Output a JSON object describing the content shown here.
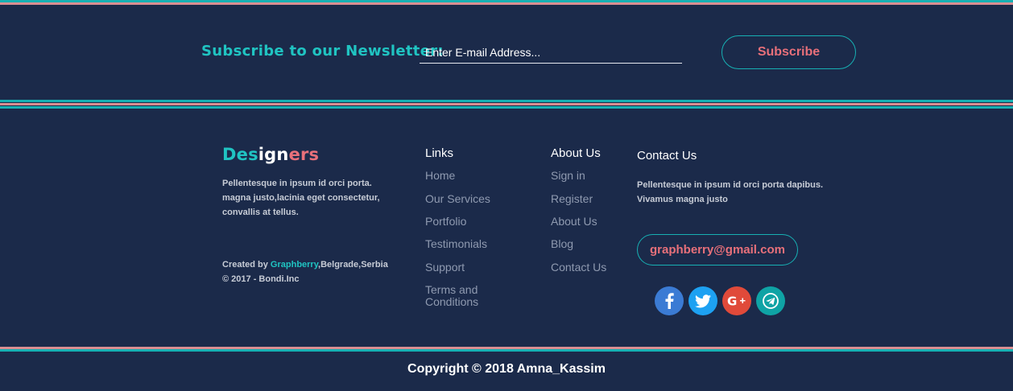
{
  "newsletter": {
    "label": "Subscribe to our Newsletter:",
    "email_placeholder": "Enter E-mail Address...",
    "subscribe_label": "Subscribe"
  },
  "brand": {
    "part1": "Des",
    "part2": "ign",
    "part3": "ers",
    "description": "Pellentesque in ipsum id orci porta. magna justo,lacinia eget consectetur, convallis at tellus.",
    "created_prefix": "Created by ",
    "created_link": "Graphberry",
    "created_suffix": ",Belgrade,Serbia",
    "copyright_line": "© 2017 - Bondi.Inc"
  },
  "links": {
    "title": "Links",
    "items": [
      "Home",
      "Our Services",
      "Portfolio",
      "Testimonials",
      "Support",
      "Terms and Conditions"
    ]
  },
  "about": {
    "title": "About Us",
    "items": [
      "Sign in",
      "Register",
      "About Us",
      "Blog",
      "Contact Us"
    ]
  },
  "contact": {
    "title": "Contact Us",
    "description": "Pellentesque in ipsum id orci porta dapibus. Vivamus magna justo",
    "email": "graphberry@gmail.com"
  },
  "social": [
    {
      "icon": "facebook-icon",
      "color": "#3b7bd4"
    },
    {
      "icon": "twitter-icon",
      "color": "#1da1f2"
    },
    {
      "icon": "google-plus-icon",
      "color": "#e04a3a"
    },
    {
      "icon": "telegram-icon",
      "color": "#0fa3a5"
    }
  ],
  "footer": {
    "copyright": "Copyright © 2018 Amna_Kassim"
  },
  "colors": {
    "background": "#1b2a4a",
    "accent_teal": "#17b0b3",
    "accent_pink": "#e8707a",
    "stripe_pink": "#d98e92"
  }
}
